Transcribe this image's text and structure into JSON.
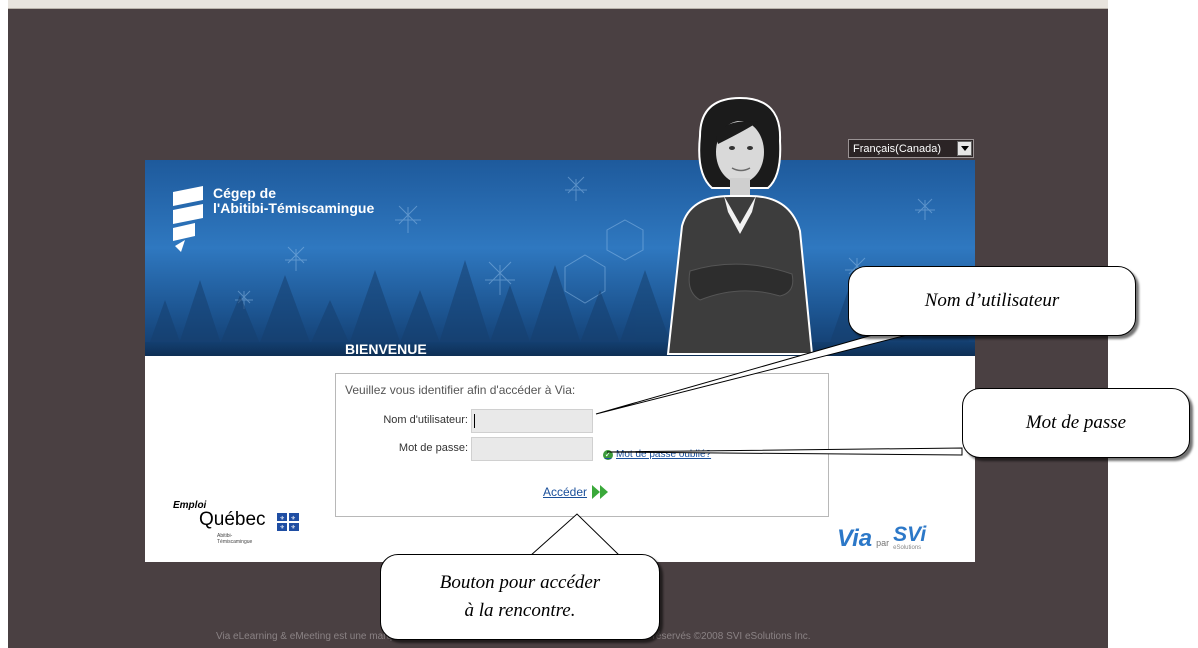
{
  "language_select": {
    "value": "Français(Canada)"
  },
  "header": {
    "org_name_line1": "Cégep de",
    "org_name_line2": "l'Abitibi-Témiscamingue",
    "welcome": "BIENVENUE"
  },
  "login": {
    "intro": "Veuillez vous identifier afin d'accéder à Via:",
    "username_label": "Nom d'utilisateur:",
    "password_label": "Mot de passe:",
    "forgot_password": "Mot de passe oublié?",
    "submit": "Accéder"
  },
  "partner": {
    "emploi": "Emploi",
    "quebec": "Québec",
    "region_line1": "Abitibi-",
    "region_line2": "Témiscamingue"
  },
  "branding": {
    "via": "Via",
    "par": "par",
    "svi": "SVi",
    "esolutions": "eSolutions"
  },
  "footer": {
    "copyright": "Via eLearning & eMeeting est une marque de commerce de SVI eSolutions Inc. 2008 - Tous droits réservés ©2008 SVI eSolutions Inc."
  },
  "callouts": {
    "username": "Nom d’utilisateur",
    "password": "Mot de passe",
    "submit_line1": "Bouton pour accéder",
    "submit_line2": "à la rencontre."
  },
  "colors": {
    "background": "#4a4042",
    "banner_blue": "#2f78c0",
    "link": "#1a4f9a",
    "via_green": "#3a9a3a"
  }
}
